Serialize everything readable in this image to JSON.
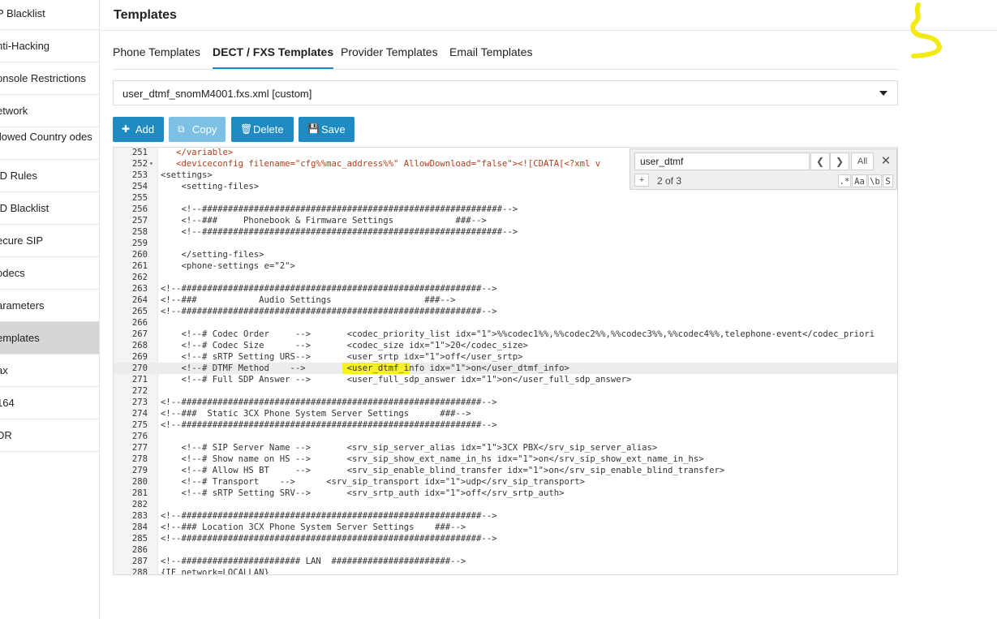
{
  "sidebar": {
    "items": [
      {
        "label": "P Blacklist"
      },
      {
        "label": "nti-Hacking"
      },
      {
        "label": "onsole Restrictions"
      },
      {
        "label": "etwork"
      },
      {
        "label": "llowed Country odes"
      },
      {
        "label": "ID Rules"
      },
      {
        "label": "ID Blacklist"
      },
      {
        "label": "ecure SIP"
      },
      {
        "label": "odecs"
      },
      {
        "label": "arameters"
      },
      {
        "label": "emplates"
      },
      {
        "label": "ax"
      },
      {
        "label": "164"
      },
      {
        "label": "DR"
      }
    ]
  },
  "header": {
    "title": "Templates"
  },
  "tabs": [
    {
      "label": "Phone Templates"
    },
    {
      "label": "DECT / FXS Templates"
    },
    {
      "label": "Provider Templates"
    },
    {
      "label": "Email Templates"
    }
  ],
  "template_select": {
    "value": "user_dtmf_snomM4001.fxs.xml [custom]"
  },
  "toolbar": {
    "add": "Add",
    "copy": "Copy",
    "delete": "Delete",
    "save": "Save"
  },
  "search": {
    "query": "user_dtmf",
    "prev_icon": "chevron-left-icon",
    "next_icon": "chevron-right-icon",
    "all_label": "All",
    "plus_label": "+",
    "count": "2 of 3",
    "regex_label": ".*",
    "case_label": "Aa",
    "word_label": "\\b",
    "selection_label": "S"
  },
  "colors": {
    "accent": "#1e8bc3",
    "accent_disabled": "#7cc0e4",
    "highlight": "#f5f02a",
    "sidebar_active": "#d6d6d6"
  },
  "editor": {
    "lines": [
      {
        "n": "251",
        "code": "   </variable>",
        "tag": true
      },
      {
        "n": "252",
        "code": "   <deviceconfig filename=\"cfg%%mac_address%%\" AllowDownload=\"false\"><![CDATA[<?xml v",
        "tag": true,
        "fold": true
      },
      {
        "n": "253",
        "code": "<settings>"
      },
      {
        "n": "254",
        "code": "    <setting-files>"
      },
      {
        "n": "255",
        "code": ""
      },
      {
        "n": "256",
        "code": "    <!--##########################################################-->"
      },
      {
        "n": "257",
        "code": "    <!--###     Phonebook & Firmware Settings            ###-->"
      },
      {
        "n": "258",
        "code": "    <!--##########################################################-->"
      },
      {
        "n": "259",
        "code": ""
      },
      {
        "n": "260",
        "code": "    </setting-files>"
      },
      {
        "n": "261",
        "code": "    <phone-settings e=\"2\">"
      },
      {
        "n": "262",
        "code": ""
      },
      {
        "n": "263",
        "code": "<!--##########################################################-->"
      },
      {
        "n": "264",
        "code": "<!--###            Audio Settings                  ###-->"
      },
      {
        "n": "265",
        "code": "<!--##########################################################-->"
      },
      {
        "n": "266",
        "code": ""
      },
      {
        "n": "267",
        "code": "    <!--# Codec Order     -->       <codec_priority_list idx=\"1\">%%codec1%%,%%codec2%%,%%codec3%%,%%codec4%%,telephone-event</codec_priori"
      },
      {
        "n": "268",
        "code": "    <!--# Codec Size      -->       <codec_size idx=\"1\">20</codec_size>"
      },
      {
        "n": "269",
        "code": "    <!--# sRTP Setting URS-->       <user_srtp idx=\"1\">off</user_srtp>"
      },
      {
        "n": "270",
        "code": "    <!--# DTMF Method    -->        <user_dtmf_info idx=\"1\">on</user_dtmf_info>",
        "active": true
      },
      {
        "n": "271",
        "code": "    <!--# Full SDP Answer -->       <user_full_sdp_answer idx=\"1\">on</user_full_sdp_answer>"
      },
      {
        "n": "272",
        "code": ""
      },
      {
        "n": "273",
        "code": "<!--##########################################################-->"
      },
      {
        "n": "274",
        "code": "<!--###  Static 3CX Phone System Server Settings      ###-->"
      },
      {
        "n": "275",
        "code": "<!--##########################################################-->"
      },
      {
        "n": "276",
        "code": ""
      },
      {
        "n": "277",
        "code": "    <!--# SIP Server Name -->       <srv_sip_server_alias idx=\"1\">3CX PBX</srv_sip_server_alias>"
      },
      {
        "n": "278",
        "code": "    <!--# Show name on HS -->       <srv_sip_show_ext_name_in_hs idx=\"1\">on</srv_sip_show_ext_name_in_hs>"
      },
      {
        "n": "279",
        "code": "    <!--# Allow HS BT     -->       <srv_sip_enable_blind_transfer idx=\"1\">on</srv_sip_enable_blind_transfer>"
      },
      {
        "n": "280",
        "code": "    <!--# Transport    -->      <srv_sip_transport idx=\"1\">udp</srv_sip_transport>"
      },
      {
        "n": "281",
        "code": "    <!--# sRTP Setting SRV-->       <srv_srtp_auth idx=\"1\">off</srv_srtp_auth>"
      },
      {
        "n": "282",
        "code": ""
      },
      {
        "n": "283",
        "code": "<!--##########################################################-->"
      },
      {
        "n": "284",
        "code": "<!--### Location 3CX Phone System Server Settings    ###-->"
      },
      {
        "n": "285",
        "code": "<!--##########################################################-->"
      },
      {
        "n": "286",
        "code": ""
      },
      {
        "n": "287",
        "code": "<!--####################### LAN  #######################-->"
      },
      {
        "n": "288",
        "code": "{IF network=LOCALLAN}"
      }
    ]
  }
}
